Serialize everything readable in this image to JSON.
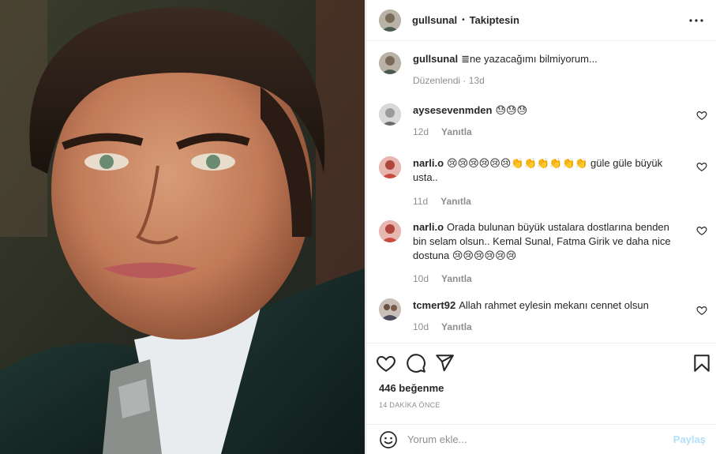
{
  "post": {
    "author": "gullsunal",
    "separator": "•",
    "follow_status": "Takiptesin",
    "more_icon": "more-horizontal-icon"
  },
  "caption": {
    "username": "gullsunal",
    "text": "≣ne yazacağımı bilmiyorum...",
    "edited": "Düzenlendi",
    "age": "13d"
  },
  "comments": [
    {
      "username": "aysesevenmden",
      "text": "😓😓😓",
      "age": "12d",
      "reply": "Yanıtla"
    },
    {
      "username": "narli.o",
      "text": "😢😢😢😢😢😢👏👏👏👏👏👏 güle güle büyük usta..",
      "age": "11d",
      "reply": "Yanıtla"
    },
    {
      "username": "narli.o",
      "text": "Orada bulunan büyük ustalara dostlarına benden bin selam olsun.. Kemal Sunal, Fatma Girik ve daha nice dostuna 😢😢😢😢😢😢",
      "age": "10d",
      "reply": "Yanıtla"
    },
    {
      "username": "tcmert92",
      "text": "Allah rahmet eylesin mekanı cennet olsun",
      "age": "10d",
      "reply": "Yanıtla"
    }
  ],
  "stats": {
    "likes": "446 beğenme",
    "posted": "14 DAKİKA ÖNCE"
  },
  "composer": {
    "placeholder": "Yorum ekle...",
    "share_label": "Paylaş"
  },
  "colors": {
    "text": "#262626",
    "secondary": "#8e8e8e",
    "divider": "#efefef",
    "share_disabled": "#b2dffc"
  }
}
